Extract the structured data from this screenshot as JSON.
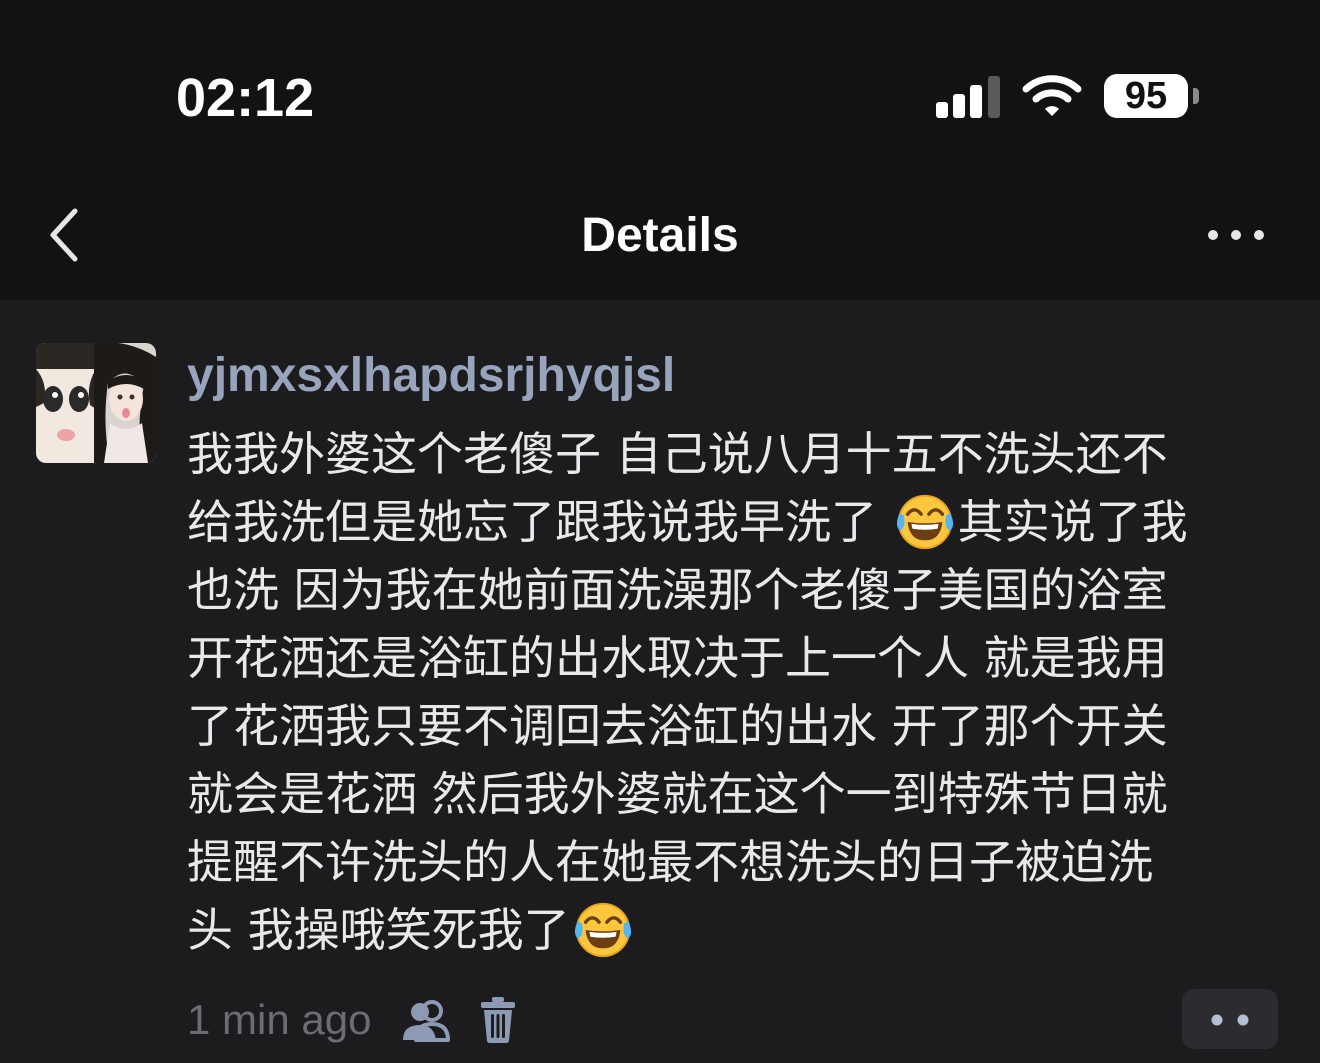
{
  "status_bar": {
    "time": "02:12",
    "battery_level": "95",
    "icons": [
      "signal-icon",
      "wifi-icon",
      "battery-icon"
    ]
  },
  "nav": {
    "title": "Details",
    "back_icon": "chevron-left-icon",
    "more_icon": "more-horizontal-icon"
  },
  "comment": {
    "username": "yjmxsxlhapdsrjhyqjsl",
    "lines": [
      [
        "我我外婆这个老傻子 自己说八月十五不洗头还不"
      ],
      [
        "给我洗但是她忘了跟我说我早洗了 ",
        "其实说了我"
      ],
      [
        "也洗 因为我在她前面洗澡那个老傻子美国的浴室"
      ],
      [
        "开花洒还是浴缸的出水取决于上一个人 就是我用"
      ],
      [
        "了花洒我只要不调回去浴缸的出水 开了那个开关"
      ],
      [
        "就会是花洒 然后我外婆就在这个一到特殊节日就"
      ],
      [
        "提醒不许洗头的人在她最不想洗头的日子被迫洗"
      ],
      [
        "头 我操哦笑死我了",
        ""
      ]
    ],
    "emoji": "face-with-tears-of-joy-icon",
    "timestamp": "1 min ago",
    "footer_icons": [
      "users-icon",
      "trash-icon",
      "more-horizontal-icon"
    ]
  },
  "colors": {
    "background": "#1c1c1e",
    "header_background": "#121212",
    "username": "#98a3bc",
    "text": "#e9e9ec",
    "muted": "#6c6c72",
    "icon_muted": "#8e9ab4"
  }
}
